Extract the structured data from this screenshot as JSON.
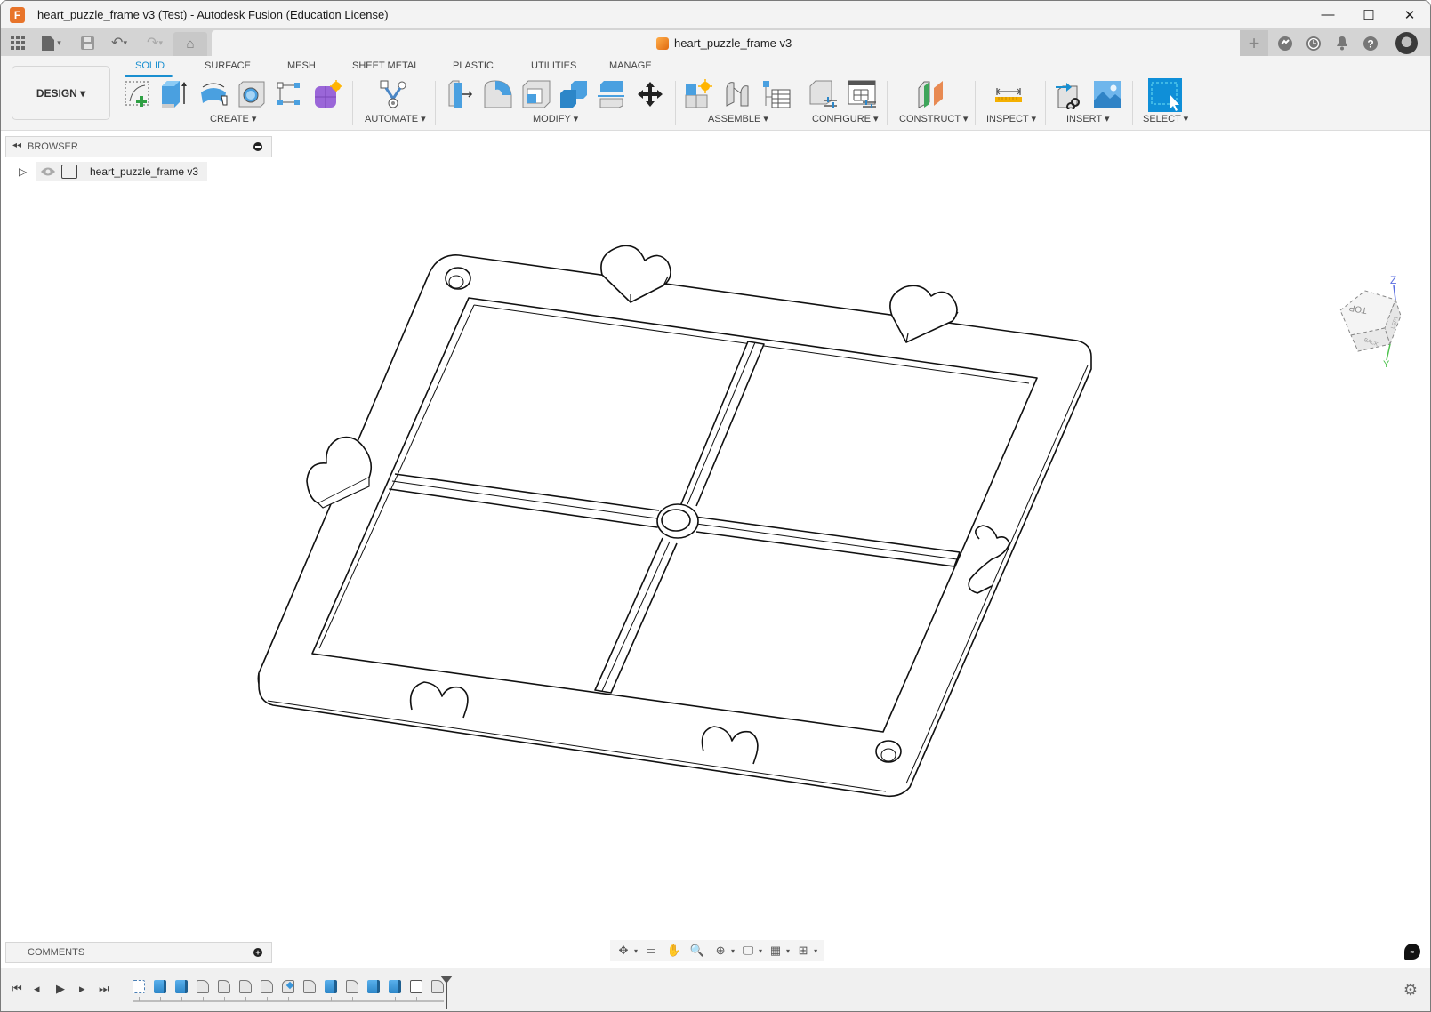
{
  "window": {
    "title": "heart_puzzle_frame v3 (Test) - Autodesk Fusion (Education License)",
    "app_logo_letter": "F",
    "controls": {
      "minimize": "—",
      "maximize": "☐",
      "close": "✕"
    }
  },
  "quick_access": {
    "icons": [
      "grid-menu-icon",
      "file-icon",
      "save-icon",
      "undo-icon",
      "redo-icon",
      "home-icon"
    ],
    "glyphs": {
      "grid": "▦",
      "file": "🗋",
      "file_caret": "▾",
      "save": "💾",
      "undo": "↶",
      "undo_caret": "▾",
      "redo": "↷",
      "redo_caret": "▾",
      "home": "⌂"
    }
  },
  "document_tab": {
    "label": "heart_puzzle_frame v3",
    "close": "✕"
  },
  "top_right": {
    "new_tab": "+",
    "extensions": "⟲",
    "job_status": "◷",
    "notifications": "🔔",
    "help": "?"
  },
  "ribbon": {
    "workspace": "DESIGN ▾",
    "tabs": [
      {
        "label": "SOLID",
        "active": true
      },
      {
        "label": "SURFACE",
        "active": false
      },
      {
        "label": "MESH",
        "active": false
      },
      {
        "label": "SHEET METAL",
        "active": false
      },
      {
        "label": "PLASTIC",
        "active": false
      },
      {
        "label": "UTILITIES",
        "active": false
      },
      {
        "label": "MANAGE",
        "active": false
      }
    ],
    "groups": [
      {
        "label": "CREATE ▾",
        "tools": [
          "create-sketch",
          "extrude",
          "revolve",
          "hole",
          "pattern",
          "create-form"
        ]
      },
      {
        "label": "AUTOMATE ▾",
        "tools": [
          "automate"
        ]
      },
      {
        "label": "MODIFY ▾",
        "tools": [
          "press-pull",
          "fillet",
          "shell",
          "combine",
          "split-body",
          "move-copy"
        ]
      },
      {
        "label": "ASSEMBLE ▾",
        "tools": [
          "new-component",
          "joint",
          "bill-of-materials"
        ]
      },
      {
        "label": "CONFIGURE ▾",
        "tools": [
          "configure-model",
          "configuration-table"
        ]
      },
      {
        "label": "CONSTRUCT ▾",
        "tools": [
          "offset-plane"
        ]
      },
      {
        "label": "INSPECT ▾",
        "tools": [
          "measure"
        ]
      },
      {
        "label": "INSERT ▾",
        "tools": [
          "insert-derive",
          "insert-canvas"
        ]
      },
      {
        "label": "SELECT ▾",
        "tools": [
          "select"
        ]
      }
    ]
  },
  "browser": {
    "header": "BROWSER",
    "collapse_glyph": "◂◂",
    "items": [
      {
        "label": "heart_puzzle_frame v3",
        "expand_glyph": "▷",
        "visible_glyph": "👁"
      }
    ]
  },
  "viewcube": {
    "faces": {
      "top": "TOP",
      "left": "LEFT",
      "back": "BACK"
    },
    "axes": {
      "z": "Z",
      "y": "Y"
    },
    "colors": {
      "z": "#5b6ee0",
      "y": "#4dc24d"
    }
  },
  "comments": {
    "label": "COMMENTS",
    "add_glyph": "+"
  },
  "navbar": {
    "tools": [
      {
        "name": "orbit",
        "glyph": "✥",
        "dropdown": true
      },
      {
        "name": "look-at",
        "glyph": "▭",
        "dropdown": false
      },
      {
        "name": "pan",
        "glyph": "✋",
        "dropdown": false
      },
      {
        "name": "zoom",
        "glyph": "🔍",
        "dropdown": false
      },
      {
        "name": "fit",
        "glyph": "⊕",
        "dropdown": true
      },
      {
        "name": "display-settings",
        "glyph": "🖵",
        "dropdown": true
      },
      {
        "name": "grid-snaps",
        "glyph": "▦",
        "dropdown": true
      },
      {
        "name": "viewports",
        "glyph": "⊞",
        "dropdown": true
      }
    ],
    "caret": "▾"
  },
  "timeline": {
    "controls": {
      "first": "⏮",
      "prev": "◂",
      "play": "▶",
      "next": "▸",
      "last": "⏭"
    },
    "features": [
      "sketch",
      "extrude",
      "extrude",
      "chamfer",
      "chamfer",
      "chamfer",
      "chamfer",
      "fillet",
      "chamfer",
      "extrude",
      "chamfer",
      "extrude",
      "extrude",
      "combine",
      "chamfer"
    ],
    "settings_glyph": "⚙"
  },
  "accent_colors": {
    "active_tab": "#1a8fd0",
    "select_tool": "#0f8fd8",
    "app_logo": "#e8742a"
  }
}
